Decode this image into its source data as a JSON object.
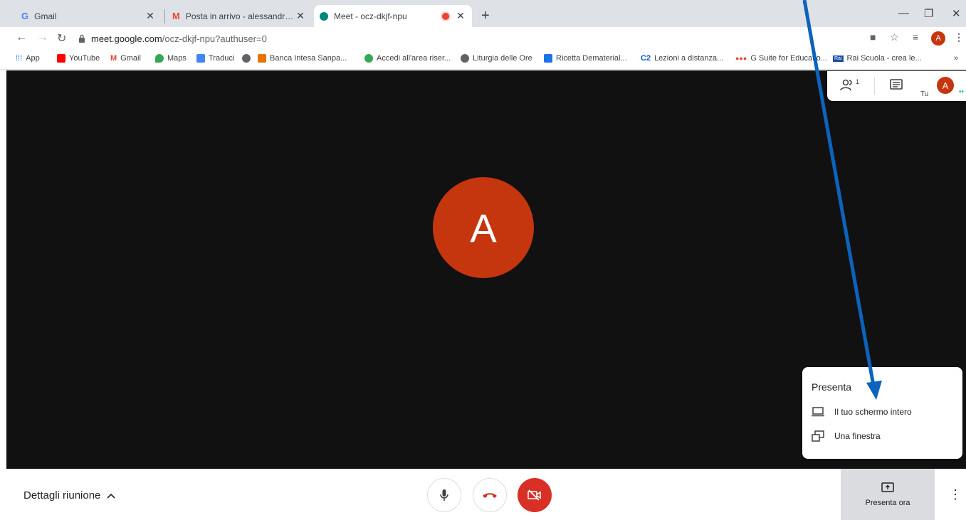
{
  "tabs": [
    {
      "title": "Gmail",
      "icon": "google-g-icon"
    },
    {
      "title": "Posta in arrivo - alessandronencio",
      "icon": "gmail-icon"
    },
    {
      "title": "Meet - ocz-dkjf-npu",
      "icon": "meet-icon",
      "active": true,
      "recording": true
    }
  ],
  "address": {
    "host": "meet.google.com",
    "path": "/ocz-dkjf-npu?authuser=0"
  },
  "profile_letter": "A",
  "bookmarks": [
    {
      "label": "App",
      "color": "#1a73e8"
    },
    {
      "label": "YouTube",
      "color": "#ff0000"
    },
    {
      "label": "Gmail",
      "color": "#ea4335"
    },
    {
      "label": "Maps",
      "color": "#34a853"
    },
    {
      "label": "Traduci",
      "color": "#4285f4"
    },
    {
      "label": "",
      "color": "#5f6368"
    },
    {
      "label": "Banca Intesa Sanpa...",
      "color": "#e37400"
    },
    {
      "label": "Accedi all'area riser...",
      "color": "#34a853"
    },
    {
      "label": "Liturgia delle Ore",
      "color": "#5f6368"
    },
    {
      "label": "Ricetta Dematerial...",
      "color": "#1a73e8"
    },
    {
      "label": "Lezioni a distanza...",
      "color": "#0b57d0"
    },
    {
      "label": "G Suite for Educatio...",
      "color": "#ea4335"
    },
    {
      "label": "Rai Scuola - crea le...",
      "color": "#174ea6"
    }
  ],
  "bookmarks_overflow": "»",
  "meeting": {
    "participant_letter": "A",
    "participants_count": "1",
    "you_label": "Tu",
    "avatar_color": "#c5350e"
  },
  "present_menu": {
    "header": "Presenta",
    "items": [
      "Il tuo schermo intero",
      "Una finestra"
    ]
  },
  "bottom": {
    "details_label": "Dettagli riunione",
    "present_now_label": "Presenta ora"
  },
  "annotation_arrow_color": "#0b63bd"
}
